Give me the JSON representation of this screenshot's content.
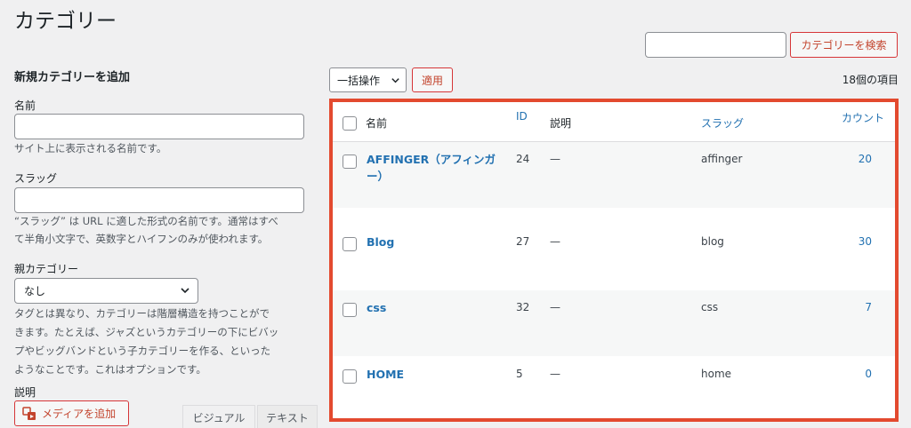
{
  "page": {
    "title": "カテゴリー"
  },
  "search": {
    "placeholder": "",
    "button_label": "カテゴリーを検索"
  },
  "add_form": {
    "heading": "新規カテゴリーを追加",
    "name_label": "名前",
    "name_value": "",
    "name_help": "サイト上に表示される名前です。",
    "slug_label": "スラッグ",
    "slug_value": "",
    "slug_help_line1": "“スラッグ” は URL に適した形式の名前です。通常はすべ",
    "slug_help_line2": "て半角小文字で、英数字とハイフンのみが使われます。",
    "parent_label": "親カテゴリー",
    "parent_selected": "なし",
    "parent_help_line1": "タグとは異なり、カテゴリーは階層構造を持つことがで",
    "parent_help_line2": "きます。たとえば、ジャズというカテゴリーの下にビバッ",
    "parent_help_line3": "プやビッグバンドという子カテゴリーを作る、といった",
    "parent_help_line4": "ようなことです。これはオプションです。",
    "description_label": "説明",
    "media_button": "メディアを追加",
    "tab_visual": "ビジュアル",
    "tab_text": "テキスト"
  },
  "bulk": {
    "selected": "一括操作",
    "apply_label": "適用",
    "items_count": "18個の項目"
  },
  "table": {
    "headers": {
      "name": "名前",
      "id": "ID",
      "description": "説明",
      "slug": "スラッグ",
      "count": "カウント"
    },
    "rows": [
      {
        "name_line1": "AFFINGER（アフィンガ",
        "name_line2": "ー）",
        "id": "24",
        "description": "—",
        "slug": "affinger",
        "count": "20"
      },
      {
        "name_line1": "Blog",
        "name_line2": "",
        "id": "27",
        "description": "—",
        "slug": "blog",
        "count": "30"
      },
      {
        "name_line1": "css",
        "name_line2": "",
        "id": "32",
        "description": "—",
        "slug": "css",
        "count": "7"
      },
      {
        "name_line1": "HOME",
        "name_line2": "",
        "id": "5",
        "description": "—",
        "slug": "home",
        "count": "0"
      }
    ]
  },
  "colors": {
    "accent_link": "#2271b1",
    "highlight_border": "#e34a2f",
    "button_red": "#d63638"
  }
}
